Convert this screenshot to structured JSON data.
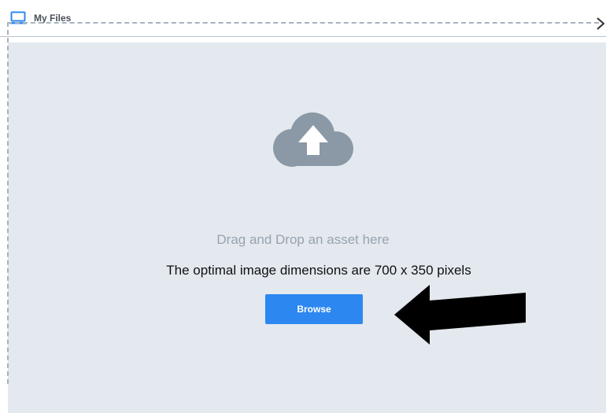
{
  "header": {
    "tab_label": "My Files",
    "accent_color": "#2d87f0"
  },
  "dropzone": {
    "drag_text": "Drag and Drop an asset here",
    "dimensions_text": "The optimal image dimensions are 700 x 350 pixels",
    "browse_label": "Browse",
    "icon": "cloud-upload-icon",
    "background_color": "#e3e9ef"
  },
  "icons": {
    "tab": "laptop-icon",
    "next": "chevron-right-icon",
    "annotation": "arrow-left-icon"
  }
}
